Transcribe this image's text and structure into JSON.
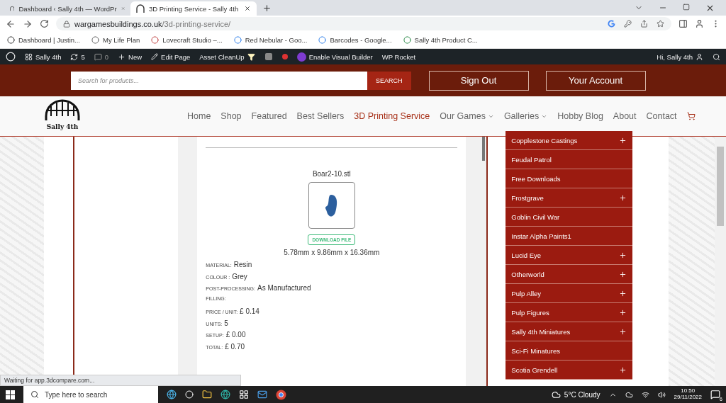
{
  "browser": {
    "tabs": [
      {
        "title": "Dashboard ‹ Sally 4th — WordPr",
        "selected": false
      },
      {
        "title": "3D Printing Service - Sally 4th",
        "selected": true
      }
    ],
    "url": {
      "domain": "wargamesbuildings.co.uk",
      "path": "/3d-printing-service/"
    },
    "bookmarks": [
      "Dashboard | Justin...",
      "My Life Plan",
      "Lovecraft Studio –...",
      "Red Nebular - Goo...",
      "Barcodes - Google...",
      "Sally 4th Product C..."
    ],
    "status_text": "Waiting for app.3dcompare.com..."
  },
  "admin_bar": {
    "site": "Sally 4th",
    "updates": "5",
    "comments": "0",
    "new": "New",
    "edit": "Edit Page",
    "asset": "Asset CleanUp",
    "builder": "Enable Visual Builder",
    "rocket": "WP Rocket",
    "greeting": "Hi, Sally 4th"
  },
  "header": {
    "search_placeholder": "Search for products...",
    "search_button": "SEARCH",
    "buttons": [
      "Sign Out",
      "Your Account"
    ]
  },
  "logo": {
    "text": "Sally 4th"
  },
  "nav": [
    {
      "label": "Home",
      "selected": false,
      "has_menu": false
    },
    {
      "label": "Shop",
      "selected": false,
      "has_menu": false
    },
    {
      "label": "Featured",
      "selected": false,
      "has_menu": false
    },
    {
      "label": "Best Sellers",
      "selected": false,
      "has_menu": false
    },
    {
      "label": "3D Printing Service",
      "selected": true,
      "has_menu": false
    },
    {
      "label": "Our Games",
      "selected": false,
      "has_menu": true
    },
    {
      "label": "Galleries",
      "selected": false,
      "has_menu": true
    },
    {
      "label": "Hobby Blog",
      "selected": false,
      "has_menu": false
    },
    {
      "label": "About",
      "selected": false,
      "has_menu": false
    },
    {
      "label": "Contact",
      "selected": false,
      "has_menu": false
    }
  ],
  "file": {
    "name": "Boar2-10.stl",
    "download": "DOWNLOAD FILE",
    "dimensions": "5.78mm x 9.86mm x 16.36mm",
    "properties": [
      {
        "label": "MATERIAL:",
        "value": "Resin"
      },
      {
        "label": "COLOUR :",
        "value": "Grey"
      },
      {
        "label": "POST-PROCESSING:",
        "value": "As Manufactured"
      },
      {
        "label": "FILLING:"
      },
      {
        "label": "PRICE / UNIT:",
        "value": "£ 0.14"
      },
      {
        "label": "UNITS:",
        "value": "5"
      },
      {
        "label": "SETUP:",
        "value": "£ 0.00"
      },
      {
        "label": "TOTAL:",
        "value": "£ 0.70"
      }
    ]
  },
  "sidebar_menu": [
    {
      "label": "Copplestone Castings",
      "expandable": true
    },
    {
      "label": "Feudal Patrol",
      "expandable": false
    },
    {
      "label": "Free Downloads",
      "expandable": false
    },
    {
      "label": "Frostgrave",
      "expandable": true
    },
    {
      "label": "Goblin Civil War",
      "expandable": false
    },
    {
      "label": "Instar Alpha Paints1",
      "expandable": false
    },
    {
      "label": "Lucid Eye",
      "expandable": true
    },
    {
      "label": "Otherworld",
      "expandable": true
    },
    {
      "label": "Pulp Alley",
      "expandable": true
    },
    {
      "label": "Pulp Figures",
      "expandable": true
    },
    {
      "label": "Sally 4th Miniatures",
      "expandable": true
    },
    {
      "label": "Sci-Fi Minatures",
      "expandable": false
    },
    {
      "label": "Scotia Grendell",
      "expandable": true
    }
  ],
  "taskbar": {
    "search_placeholder": "Type here to search",
    "weather": "5°C Cloudy",
    "time": "10:50",
    "date": "29/11/2022",
    "notifications": "6"
  }
}
